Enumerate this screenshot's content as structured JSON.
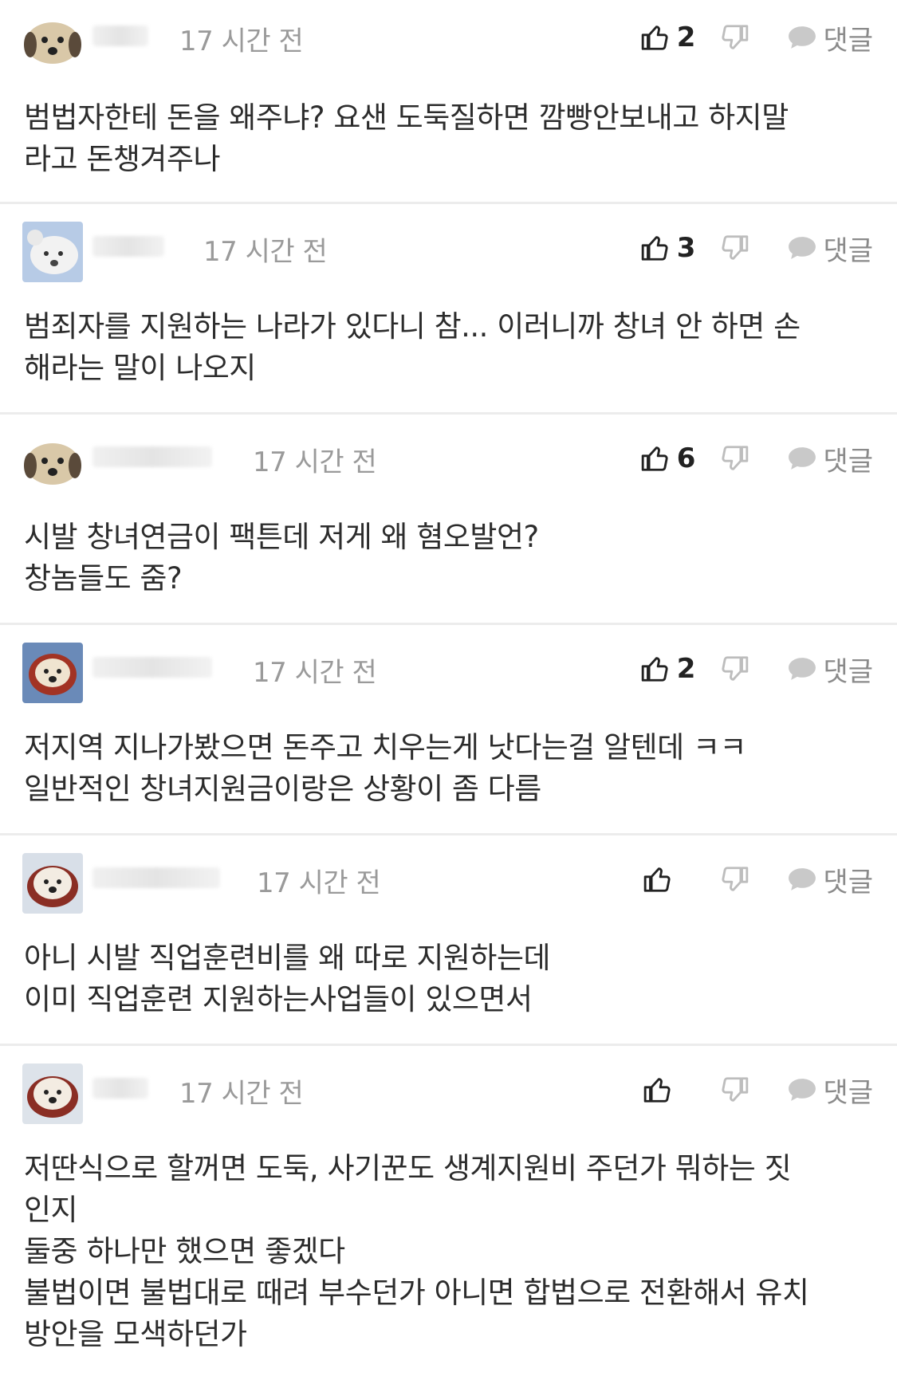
{
  "reply_label": "댓글",
  "comments": [
    {
      "time": "17 시간 전",
      "likes": "2",
      "text": "범법자한테 돈을 왜주냐? 요샌 도둑질하면 깜빵안보내고 하지말\n라고 돈챙겨주나"
    },
    {
      "time": "17 시간 전",
      "likes": "3",
      "text": "범죄자를 지원하는 나라가 있다니 참... 이러니까 창녀 안 하면 손\n해라는 말이 나오지"
    },
    {
      "time": "17 시간 전",
      "likes": "6",
      "text": "시발 창녀연금이 팩튼데 저게 왜 혐오발언?\n창놈들도 줌?"
    },
    {
      "time": "17 시간 전",
      "likes": "2",
      "text": "저지역 지나가봤으면 돈주고 치우는게 낫다는걸 알텐데 ㅋㅋ\n일반적인 창녀지원금이랑은 상황이 좀 다름"
    },
    {
      "time": "17 시간 전",
      "likes": "",
      "text": "아니 시발 직업훈련비를 왜 따로 지원하는데\n이미 직업훈련 지원하는사업들이 있으면서"
    },
    {
      "time": "17 시간 전",
      "likes": "",
      "text": "저딴식으로 할꺼면 도둑, 사기꾼도 생계지원비 주던가 뭐하는 짓\n인지\n둘중 하나만 했으면 좋겠다\n불법이면 불법대로 때려 부수던가 아니면 합법으로 전환해서 유치\n방안을 모색하던가"
    }
  ]
}
